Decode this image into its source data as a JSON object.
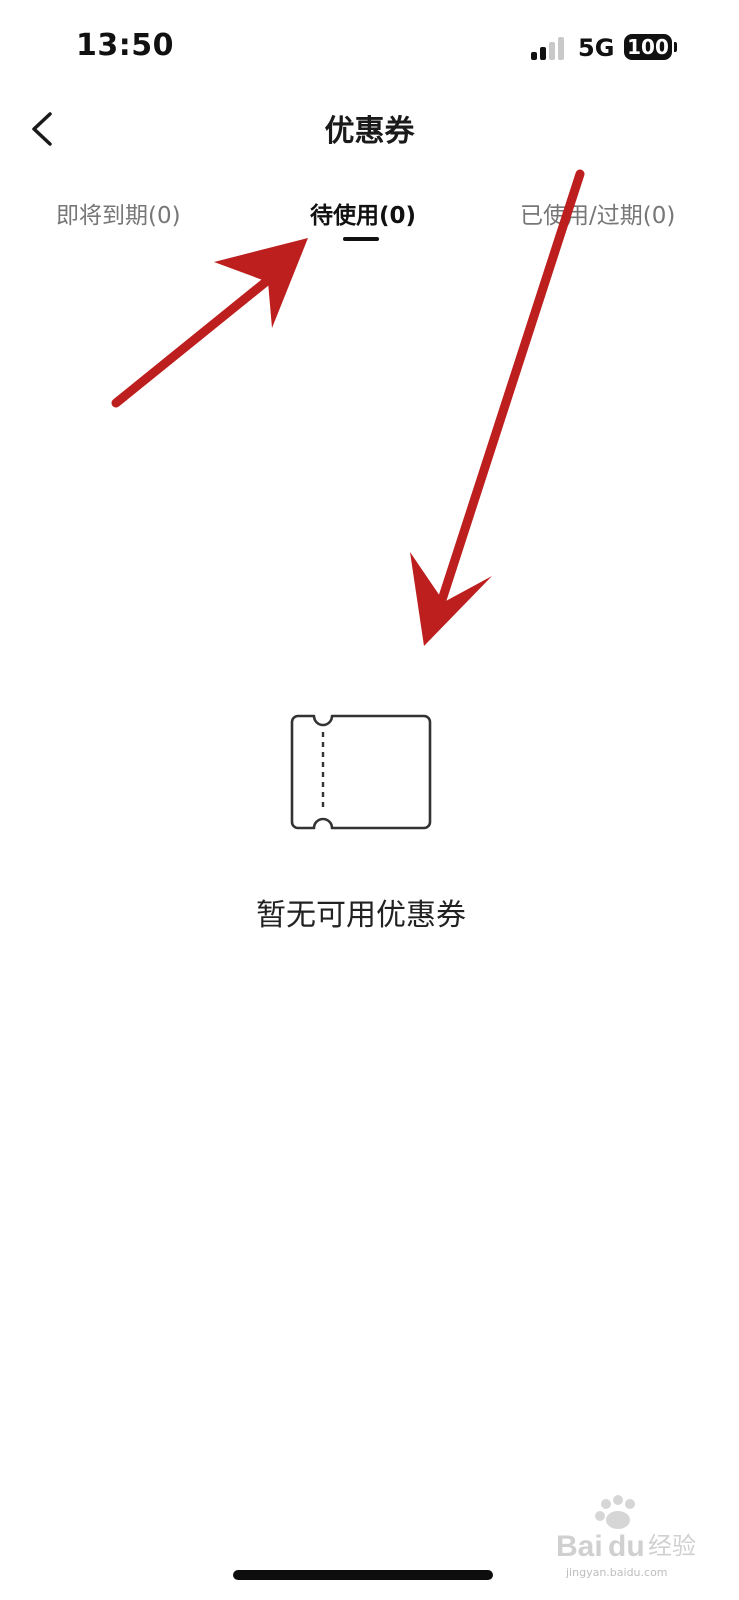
{
  "status_bar": {
    "time": "13:50",
    "network": "5G",
    "battery": "100"
  },
  "header": {
    "back_icon": "chevron-left-icon",
    "title": "优惠券"
  },
  "tabs": [
    {
      "label": "即将到期(0)",
      "active": false
    },
    {
      "label": "待使用(0)",
      "active": true
    },
    {
      "label": "已使用/过期(0)",
      "active": false
    }
  ],
  "empty_state": {
    "icon": "coupon-ticket-icon",
    "message": "暂无可用优惠券"
  },
  "watermark": {
    "logo": "Baidu经验",
    "url": "jingyan.baidu.com"
  },
  "colors": {
    "annotation_arrow": "#bd1e1e",
    "active_tab": "#111111",
    "inactive_tab": "#777777"
  }
}
